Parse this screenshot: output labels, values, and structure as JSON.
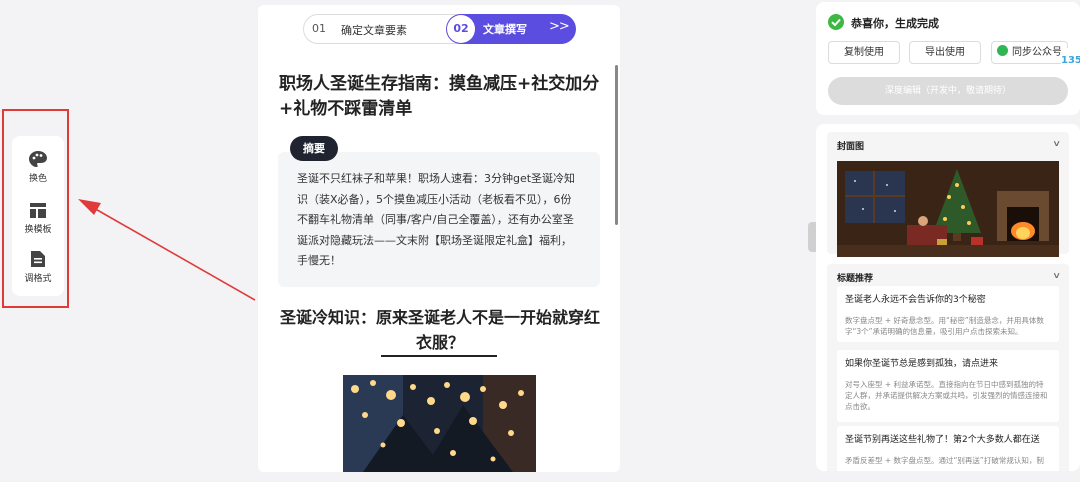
{
  "toolbar": {
    "items": [
      {
        "label": "换色",
        "icon": "palette-icon"
      },
      {
        "label": "换模板",
        "icon": "template-icon"
      },
      {
        "label": "调格式",
        "icon": "format-icon"
      }
    ]
  },
  "steps": {
    "step1_num": "01",
    "step1_label": "确定文章要素",
    "step2_num": "02",
    "step2_label": "文章撰写",
    "step2_arrows": ">>"
  },
  "article": {
    "title": "职场人圣诞生存指南：摸鱼减压+社交加分+礼物不踩雷清单",
    "summary_badge": "摘要",
    "summary": "圣诞不只红袜子和苹果！职场人速看：3分钟get圣诞冷知识（装X必备），5个摸鱼减压小活动（老板看不见），6份不翻车礼物清单（同事/客户/自己全覆盖），还有办公室圣诞派对隐藏玩法——文末附【职场圣诞限定礼盒】福利，手慢无！",
    "section_title": "圣诞冷知识：原来圣诞老人不是一开始就穿红衣服？",
    "image_icon": "christmas-lights-photo"
  },
  "result": {
    "status": "恭喜你，生成完成",
    "copy_button": "复制使用",
    "export_button": "导出使用",
    "sync_button": "同步公众号",
    "deep_edit_button": "深度编辑（开发中，敬请期待）",
    "logo_text": "135"
  },
  "cover": {
    "heading": "封面图",
    "image_icon": "christmas-livingroom-photo"
  },
  "title_suggestions": {
    "heading": "标题推荐",
    "items": [
      {
        "title": "圣诞老人永远不会告诉你的3个秘密",
        "desc": "数字盘点型 + 好奇悬念型。用“秘密”制造悬念，并用具体数字“3个”承诺明确的信息量，吸引用户点击探索未知。"
      },
      {
        "title": "如果你圣诞节总是感到孤独，请点进来",
        "desc": "对号入座型 + 利益承诺型。直接指向在节日中感到孤独的特定人群，并承诺提供解决方案或共鸣，引发强烈的情感连接和点击欲。"
      },
      {
        "title": "圣诞节别再送这些礼物了！第2个大多数人都在送",
        "desc": "矛盾反差型 + 数字盘点型。通过“别再送”打破常规认知，制"
      }
    ]
  },
  "colors": {
    "accent": "#5b4de0",
    "success": "#3db843",
    "highlight": "#e03a3a"
  }
}
